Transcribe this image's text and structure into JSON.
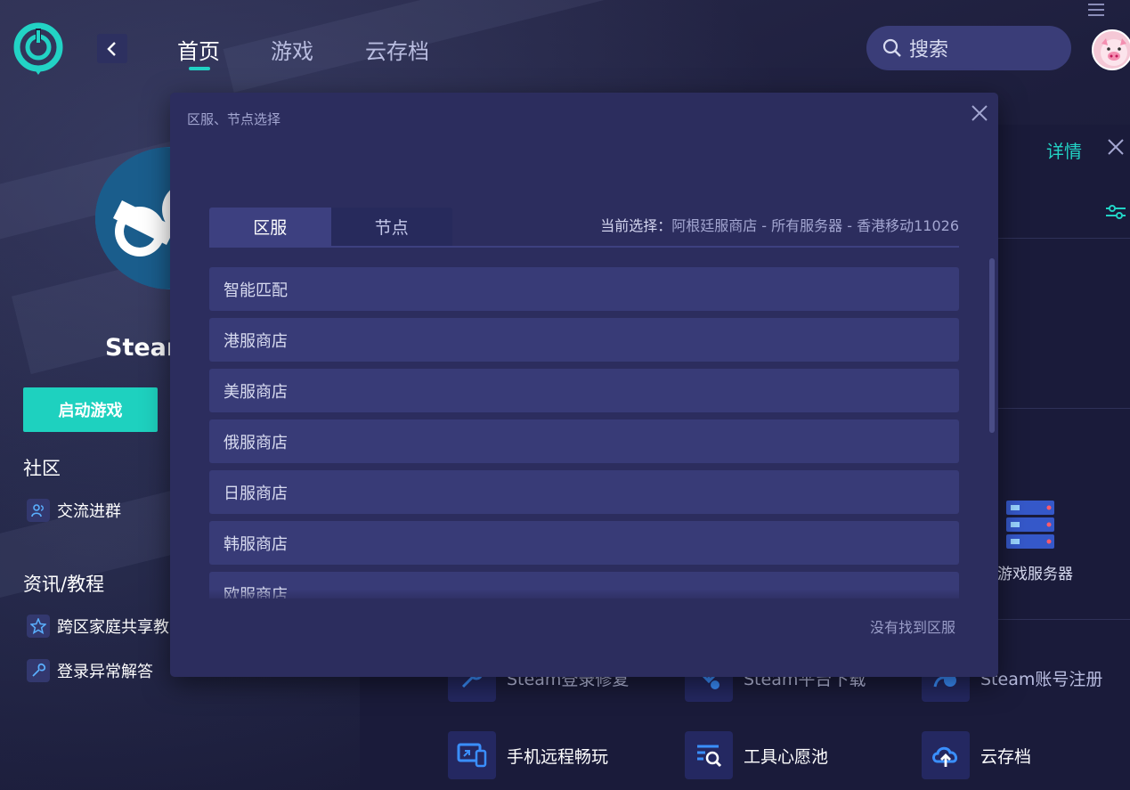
{
  "header": {
    "tabs": [
      {
        "label": "首页",
        "active": true
      },
      {
        "label": "游戏",
        "active": false
      },
      {
        "label": "云存档",
        "active": false
      }
    ],
    "search_placeholder": "搜索"
  },
  "left": {
    "game_title": "Steam",
    "launch_label": "启动游戏",
    "community_title": "社区",
    "community_links": [
      {
        "label": "交流进群",
        "icon": "users-icon"
      }
    ],
    "news_title": "资讯/教程",
    "news_links": [
      {
        "label": "跨区家庭共享教",
        "icon": "star-icon"
      },
      {
        "label": "登录异常解答",
        "icon": "wrench-icon"
      }
    ]
  },
  "right": {
    "detail_label": "详情",
    "server_label": "游戏服务器",
    "tools_row1": [
      "Steam登录修复",
      "Steam平台下载",
      "Steam账号注册"
    ],
    "tools_row2": [
      "手机远程畅玩",
      "工具心愿池",
      "云存档"
    ]
  },
  "modal": {
    "title": "区服、节点选择",
    "tabs": [
      "区服",
      "节点"
    ],
    "current_label": "当前选择：",
    "current_value": "阿根廷服商店 - 所有服务器 - 香港移动11026",
    "items": [
      "智能匹配",
      "港服商店",
      "美服商店",
      "俄服商店",
      "日服商店",
      "韩服商店",
      "欧服商店"
    ],
    "not_found": "没有找到区服"
  },
  "colors": {
    "accent": "#22d3c5",
    "modal_bg": "#2c2d5e",
    "list_item_bg": "#383b77",
    "page_bg": "#1b1c3a"
  }
}
